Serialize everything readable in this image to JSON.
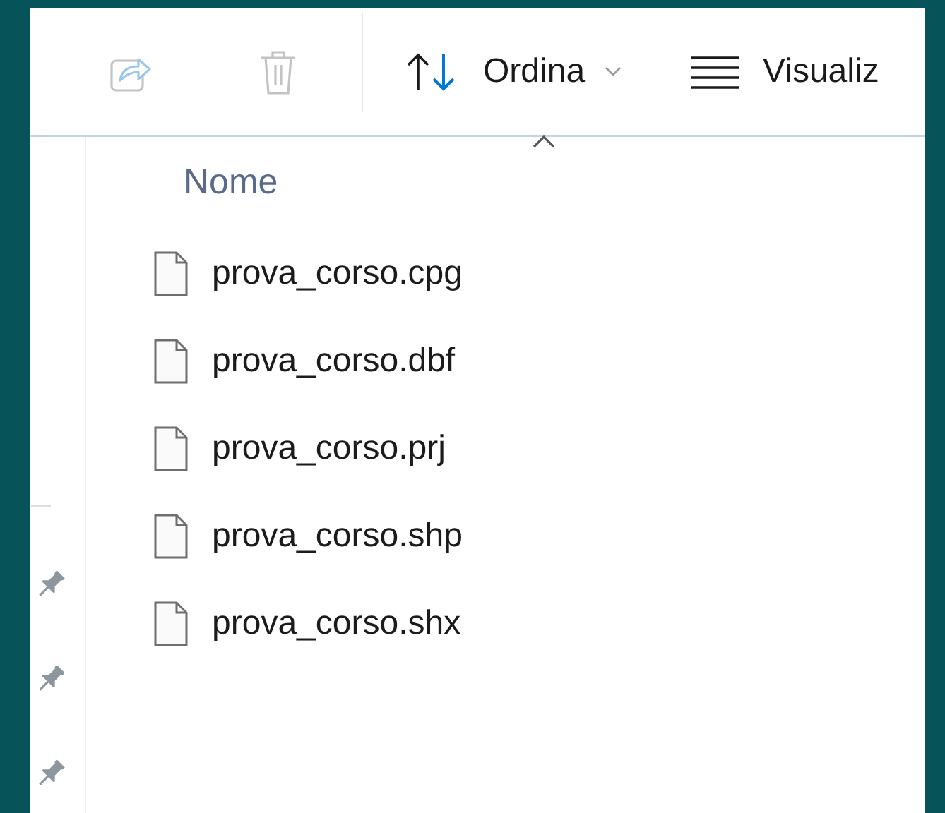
{
  "toolbar": [
    {
      "kind": "share",
      "disabled": true
    },
    {
      "kind": "delete",
      "disabled": true
    },
    {
      "kind": "separator"
    },
    {
      "kind": "sort",
      "label": "Ordina",
      "disabled": false,
      "dropdown": true
    },
    {
      "kind": "view",
      "label": "Visualiz",
      "disabled": false
    }
  ],
  "nav_items": [
    {
      "pinned": true
    },
    {
      "pinned": true
    },
    {
      "pinned": true
    }
  ],
  "columns": [
    {
      "label": "Nome",
      "sorted": true
    }
  ],
  "files": [
    {
      "name": "prova_corso.cpg"
    },
    {
      "name": "prova_corso.dbf"
    },
    {
      "name": "prova_corso.prj"
    },
    {
      "name": "prova_corso.shp"
    },
    {
      "name": "prova_corso.shx"
    }
  ]
}
